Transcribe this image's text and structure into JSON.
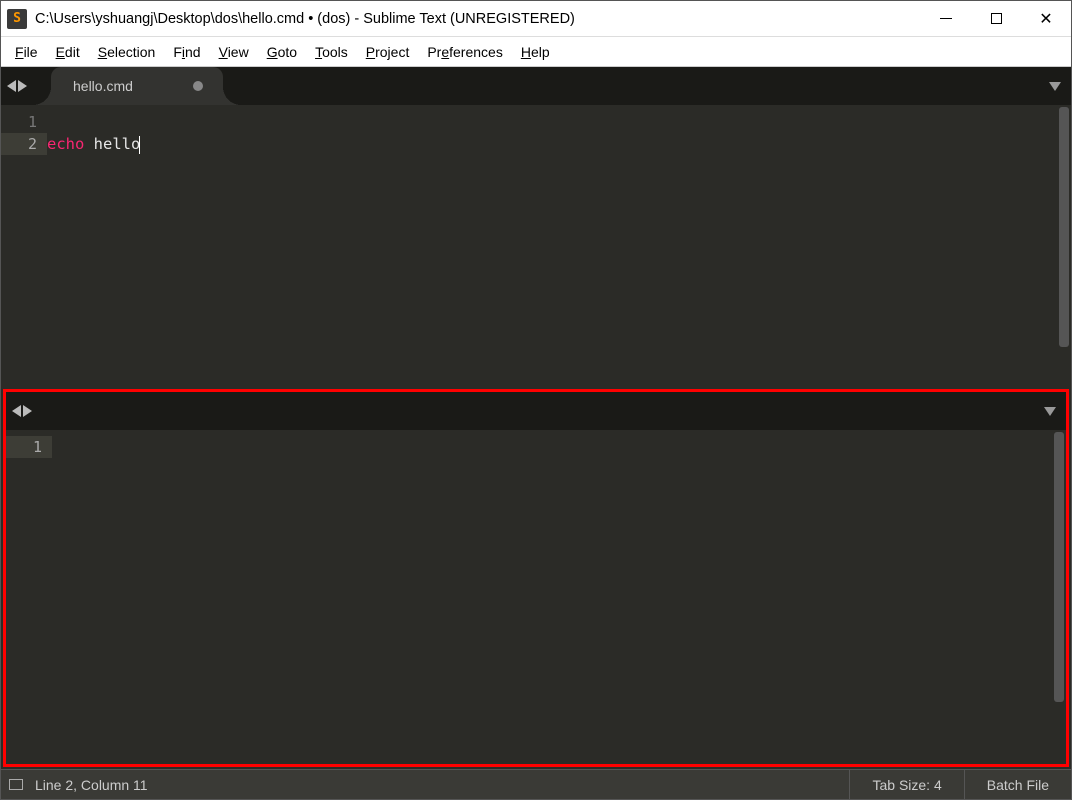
{
  "titlebar": {
    "title": "C:\\Users\\yshuangj\\Desktop\\dos\\hello.cmd • (dos) - Sublime Text (UNREGISTERED)"
  },
  "menu": {
    "file": "File",
    "edit": "Edit",
    "selection": "Selection",
    "find": "Find",
    "view": "View",
    "goto": "Goto",
    "tools": "Tools",
    "project": "Project",
    "preferences": "Preferences",
    "help": "Help"
  },
  "pane1": {
    "tab_name": "hello.cmd",
    "lines": [
      "1",
      "2"
    ],
    "current_line_idx": 1,
    "code": {
      "l1": "",
      "l2_keyword": "echo",
      "l2_rest": " hello"
    }
  },
  "pane2": {
    "lines": [
      "1"
    ]
  },
  "statusbar": {
    "position": "Line 2, Column 11",
    "tabsize": "Tab Size: 4",
    "syntax": "Batch File"
  }
}
